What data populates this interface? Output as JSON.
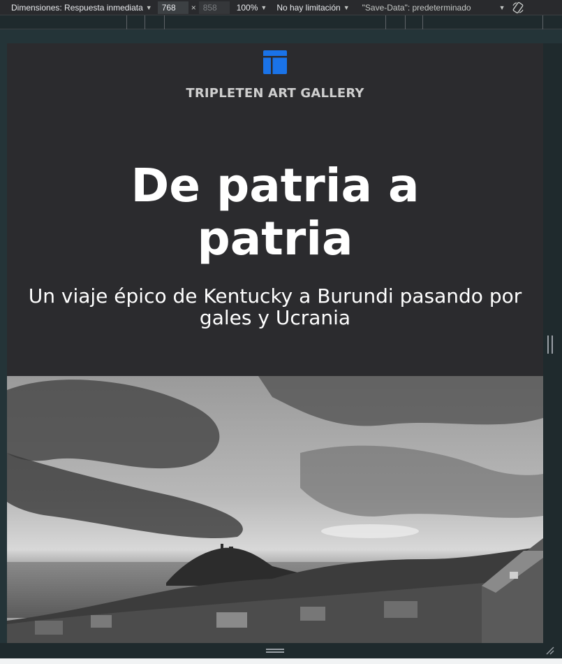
{
  "devtools": {
    "dimensions_label": "Dimensiones: Respuesta inmediata",
    "width_value": "768",
    "height_value": "858",
    "times_sign": "×",
    "zoom": "100%",
    "throttling": "No hay limitación",
    "save_data": "\"Save-Data\": predeterminado",
    "rotate_icon": "rotate-icon"
  },
  "page": {
    "logo_icon": "layout-icon",
    "logo_color": "#1a73e8",
    "brand": "TRIPLETEN ART GALLERY",
    "title": "De patria a patria",
    "subtitle": "Un viaje épico de Kentucky a Burundi pasando por gales y Ucrania",
    "background_color": "#2b2b2e",
    "photo_description": "grayscale coastal town landscape"
  }
}
